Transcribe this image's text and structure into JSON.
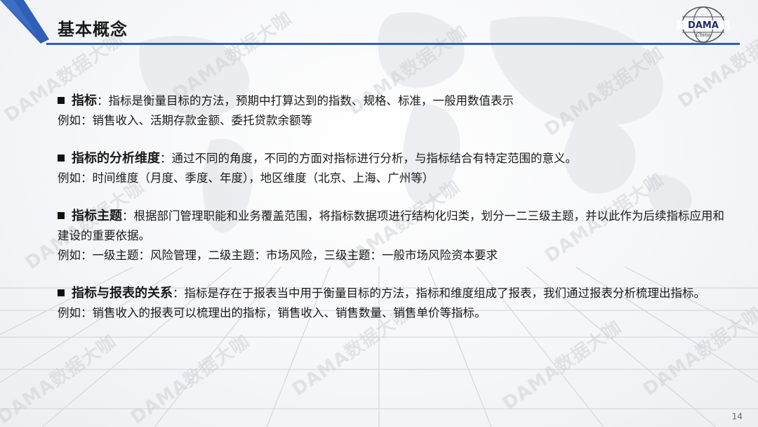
{
  "header": {
    "title": "基本概念",
    "accent_color": "#2f5fb8"
  },
  "logo": {
    "text": "DAMA",
    "subtext": "China"
  },
  "watermark": "DAMA数据大咖",
  "items": [
    {
      "term": "指标",
      "desc": "：指标是衡量目标的方法，预期中打算达到的指数、规格、标准，一般用数值表示",
      "example": "例如：销售收入、活期存款金额、委托贷款余额等"
    },
    {
      "term": "指标的分析维度",
      "desc": "：通过不同的角度，不同的方面对指标进行分析，与指标结合有特定范围的意义。",
      "example": "例如：时间维度（月度、季度、年度），地区维度（北京、上海、广州等）"
    },
    {
      "term": "指标主题",
      "desc": "：根据部门管理职能和业务覆盖范围，将指标数据项进行结构化归类，划分一二三级主题，并以此作为后续指标应用和建设的重要依据。",
      "example": "例如：一级主题：风险管理，二级主题：市场风险，三级主题：一般市场风险资本要求"
    },
    {
      "term": "指标与报表的关系",
      "desc": "：指标是存在于报表当中用于衡量目标的方法，指标和维度组成了报表，我们通过报表分析梳理出指标。",
      "example": "例如：销售收入的报表可以梳理出的指标，销售收入、销售数量、销售单价等指标。"
    }
  ],
  "page_number": "14"
}
